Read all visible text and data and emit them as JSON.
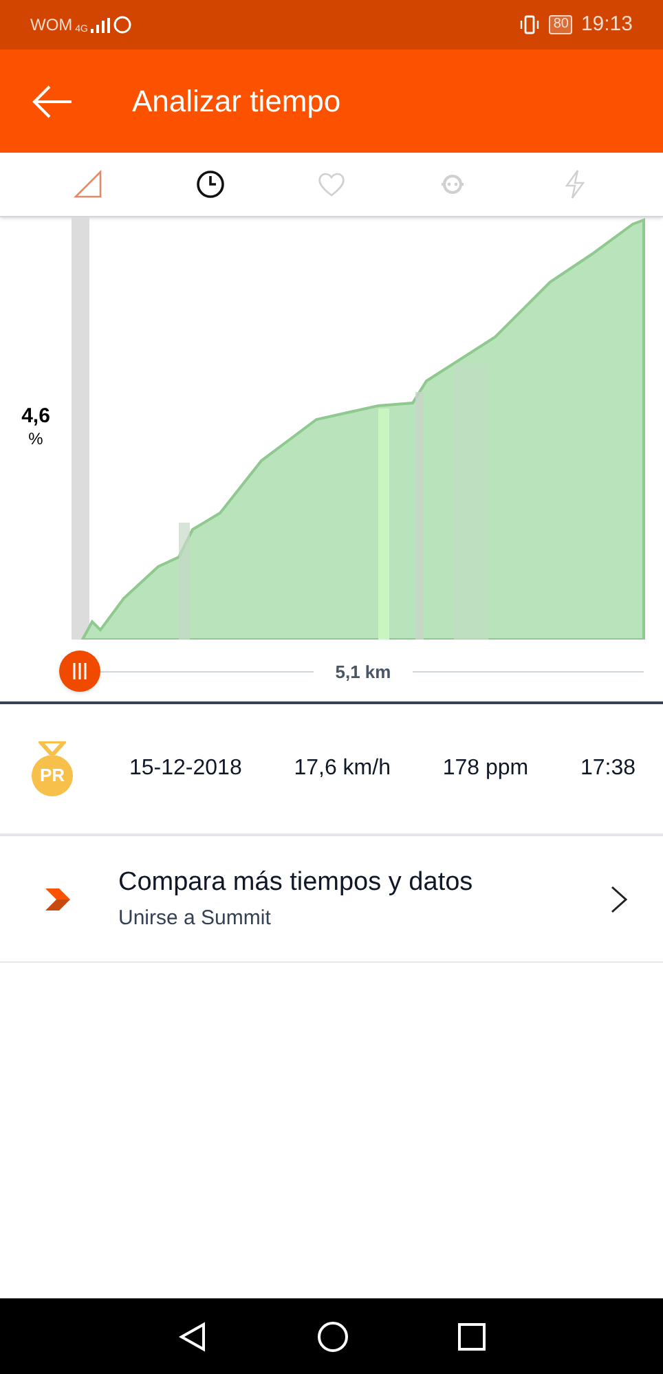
{
  "status_bar": {
    "carrier": "WOM",
    "network": "4G",
    "battery": "80",
    "time": "19:13"
  },
  "header": {
    "title": "Analizar tiempo"
  },
  "tabs": [
    {
      "kind": "grade",
      "selected": false
    },
    {
      "kind": "time",
      "selected": true
    },
    {
      "kind": "heart",
      "selected": false
    },
    {
      "kind": "cadence",
      "selected": false
    },
    {
      "kind": "power",
      "selected": false
    }
  ],
  "chart": {
    "value": "4,6",
    "unit": "%"
  },
  "slider": {
    "label": "5,1 km"
  },
  "effort": {
    "badge": "PR",
    "date": "15-12-2018",
    "speed": "17,6 km/h",
    "heart_rate": "178 ppm",
    "time": "17:38"
  },
  "promo": {
    "title": "Compara más tiempos y datos",
    "subtitle": "Unirse a Summit"
  }
}
